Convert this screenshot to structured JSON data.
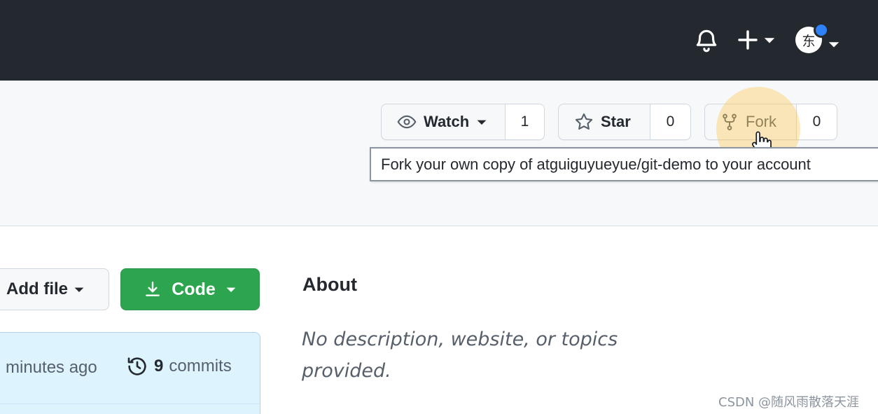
{
  "header": {
    "avatar_text": "东",
    "icons": [
      "bell-icon",
      "plus-icon",
      "caret-down-icon"
    ],
    "notification_dot_color": "#2f81f7"
  },
  "repo_actions": {
    "watch": {
      "label": "Watch",
      "count": "1"
    },
    "star": {
      "label": "Star",
      "count": "0"
    },
    "fork": {
      "label": "Fork",
      "count": "0"
    },
    "tooltip": "Fork your own copy of atguiguyueyue/git-demo to your account"
  },
  "toolbar": {
    "add_file_label": "Add file",
    "code_label": "Code",
    "code_button_color": "#2da44e"
  },
  "commit_bar": {
    "time_text": "minutes ago",
    "commits_count": "9",
    "commits_label": "commits"
  },
  "about": {
    "title": "About",
    "description": "No description, website, or topics provided."
  },
  "watermark": "CSDN @随风雨散落天涯"
}
